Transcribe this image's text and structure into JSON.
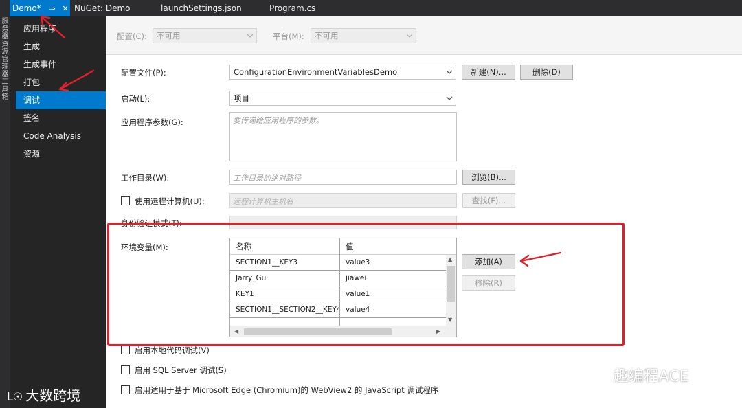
{
  "tabs": [
    {
      "label": "Demo*",
      "active": true
    },
    {
      "label": "NuGet: Demo",
      "active": false
    },
    {
      "label": "launchSettings.json",
      "active": false
    },
    {
      "label": "Program.cs",
      "active": false
    }
  ],
  "tab_glyphs": {
    "pin": "⇒",
    "close": "✕"
  },
  "left_strip": [
    "服务器资源管理器",
    "工具箱"
  ],
  "nav": {
    "items": [
      {
        "label": "应用程序"
      },
      {
        "label": "生成"
      },
      {
        "label": "生成事件"
      },
      {
        "label": "打包"
      },
      {
        "label": "调试"
      },
      {
        "label": "签名"
      },
      {
        "label": "Code Analysis"
      },
      {
        "label": "资源"
      }
    ],
    "selected_index": 4
  },
  "config_bar": {
    "config_label": "配置(C):",
    "config_value": "不可用",
    "platform_label": "平台(M):",
    "platform_value": "不可用"
  },
  "form": {
    "profile_label": "配置文件(P):",
    "profile_value": "ConfigurationEnvironmentVariablesDemo",
    "new_button": "新建(N)...",
    "delete_button": "删除(D)",
    "launch_label": "启动(L):",
    "launch_value": "项目",
    "args_label": "应用程序参数(G):",
    "args_placeholder": "要传递给应用程序的参数。",
    "workdir_label": "工作目录(W):",
    "workdir_placeholder": "工作目录的绝对路径",
    "browse_button": "浏览(B)...",
    "remote_label": "使用远程计算机(U):",
    "remote_placeholder": "远程计算机主机名",
    "find_button": "查找(F)...",
    "auth_label": "身份验证模式(T):",
    "env_label": "环境变量(M):",
    "add_button": "添加(A)",
    "remove_button": "移除(R)",
    "native_debug_label": "启用本地代码调试(V)",
    "sql_debug_label": "启用 SQL Server 调试(S)",
    "webview_debug_label": "启用适用于基于 Microsoft Edge (Chromium)的 WebView2 的 JavaScript 调试程序"
  },
  "env_table": {
    "columns": [
      "名称",
      "值"
    ],
    "rows": [
      {
        "name": "SECTION1__KEY3",
        "value": "value3"
      },
      {
        "name": "Jarry_Gu",
        "value": "jiawei"
      },
      {
        "name": "KEY1",
        "value": "value1"
      },
      {
        "name": "SECTION1__SECTION2__KEY4",
        "value": "value4"
      }
    ]
  },
  "watermarks": {
    "left": "大数跨境",
    "right": "趣编程ACE"
  },
  "colors": {
    "accent": "#007acc",
    "annotation_red": "#e0202a"
  }
}
